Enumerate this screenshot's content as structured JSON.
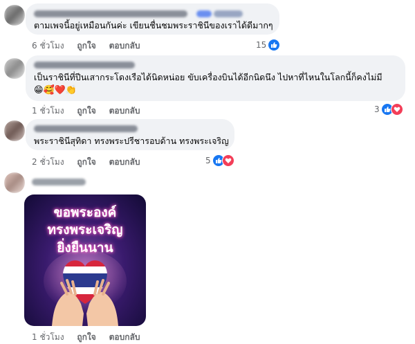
{
  "colors": {
    "bubble_bg": "#f0f2f5",
    "meta_text": "#65676b",
    "like": "#1877f2",
    "love": "#f33e58"
  },
  "comments": [
    {
      "text_lines": [
        "ตามเพจนี้อยู่เหมือนกันค่ะ เขียนชื่นชมพระราชินีของเราได้ดีมากๆ"
      ],
      "time": "6 ชั่วโมง",
      "like_label": "ถูกใจ",
      "reply_label": "ตอบกลับ",
      "reaction_count": "15",
      "reactions": [
        "like-icon"
      ]
    },
    {
      "text_lines": [
        "เป็นราชินีที่ปีนเสากระโดงเรือได้นิดหน่อย ขับเครื่องบินได้อีกนิดนึง ไปหาที่ไหนในโลกนี้ก็คงไม่มี"
      ],
      "emojis": "😁🥰❤️👏",
      "time": "1 ชั่วโมง",
      "like_label": "ถูกใจ",
      "reply_label": "ตอบกลับ",
      "reaction_count": "3",
      "reactions": [
        "like-icon",
        "love-icon"
      ]
    },
    {
      "text_lines": [
        "พระราชินีสุทิดา ทรงพระปรีชารอบด้าน ทรงพระเจริญ"
      ],
      "time": "2 ชั่วโมง",
      "like_label": "ถูกใจ",
      "reply_label": "ตอบกลับ",
      "reaction_count": "5",
      "reactions": [
        "like-icon",
        "love-icon"
      ]
    },
    {
      "image_text": [
        "ขอพระองค์",
        "ทรงพระเจริญ",
        "ยิ่งยืนนาน"
      ],
      "time": "1 ชั่วโมง",
      "like_label": "ถูกใจ",
      "reply_label": "ตอบกลับ"
    }
  ]
}
